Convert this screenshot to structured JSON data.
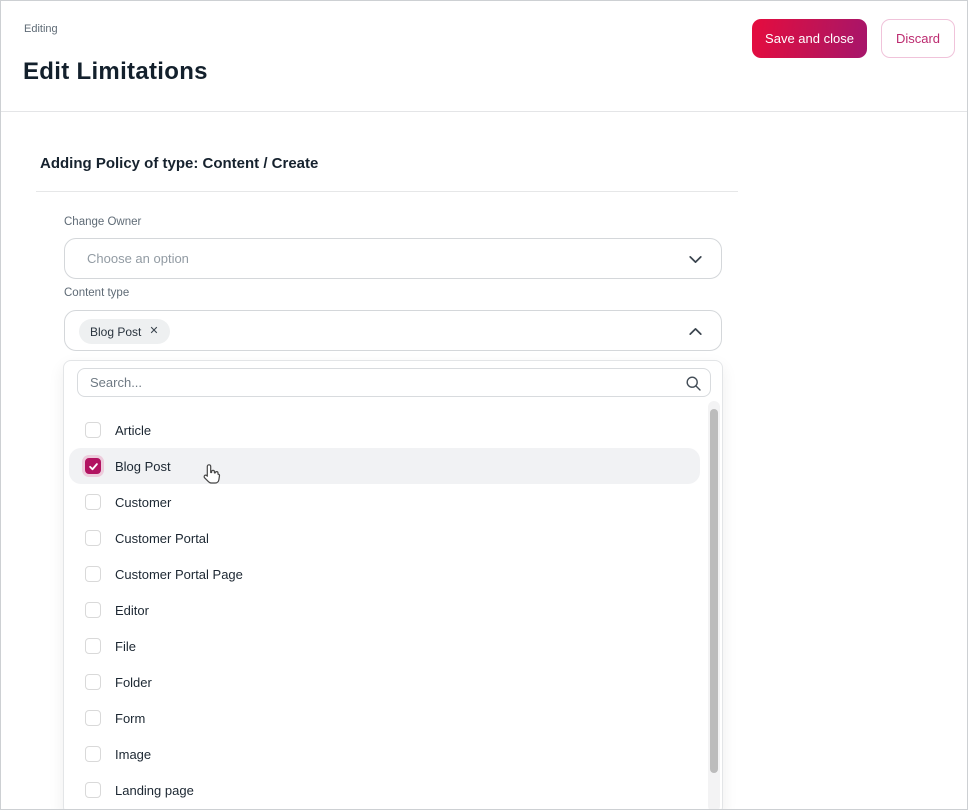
{
  "header": {
    "breadcrumb": "Editing",
    "title": "Edit Limitations",
    "buttons": {
      "save": "Save and close",
      "discard": "Discard"
    }
  },
  "panel": {
    "section_title": "Adding Policy of type: Content / Create",
    "fields": {
      "change_owner": {
        "label": "Change Owner",
        "placeholder": "Choose an option"
      },
      "content_type": {
        "label": "Content type",
        "chips": [
          {
            "label": "Blog Post"
          }
        ]
      }
    },
    "dropdown": {
      "search_placeholder": "Search...",
      "options": [
        {
          "label": "Article",
          "checked": false,
          "highlighted": false
        },
        {
          "label": "Blog Post",
          "checked": true,
          "highlighted": true
        },
        {
          "label": "Customer",
          "checked": false,
          "highlighted": false
        },
        {
          "label": "Customer Portal",
          "checked": false,
          "highlighted": false
        },
        {
          "label": "Customer Portal Page",
          "checked": false,
          "highlighted": false
        },
        {
          "label": "Editor",
          "checked": false,
          "highlighted": false
        },
        {
          "label": "File",
          "checked": false,
          "highlighted": false
        },
        {
          "label": "Folder",
          "checked": false,
          "highlighted": false
        },
        {
          "label": "Form",
          "checked": false,
          "highlighted": false
        },
        {
          "label": "Image",
          "checked": false,
          "highlighted": false
        },
        {
          "label": "Landing page",
          "checked": false,
          "highlighted": false
        }
      ]
    }
  },
  "icons": {
    "chip_remove": "close-icon",
    "select_collapsed": "chevron-down-icon",
    "select_expanded": "chevron-up-icon",
    "search": "search-icon",
    "pointer": "hand-cursor-icon"
  },
  "colors": {
    "accent_gradient_start": "#e50c3e",
    "accent_gradient_end": "#a6156b",
    "accent_text": "#bc2a6f",
    "checkbox_checked": "#b21361",
    "checkbox_halo": "#edccdc",
    "row_highlight": "#f1f2f4",
    "title_text": "#13202c",
    "muted_text": "#5f6b76"
  }
}
